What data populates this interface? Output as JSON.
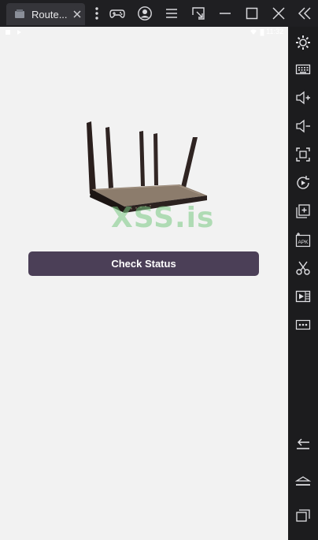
{
  "window": {
    "tab_title": "Route...",
    "icons": [
      "app-icon",
      "close-icon",
      "more-icon",
      "gamepad-icon",
      "account-icon",
      "menu-icon",
      "expand-icon",
      "minimize-icon",
      "maximize-icon",
      "close-window-icon",
      "collapse-sidebar-icon"
    ]
  },
  "sidebar": {
    "icons": [
      "settings-icon",
      "keyboard-icon",
      "volume-up-icon",
      "volume-down-icon",
      "fullscreen-icon",
      "rotate-icon",
      "add-window-icon",
      "apk-icon",
      "scissors-icon",
      "video-icon",
      "more-dots-icon",
      "back-icon",
      "home-icon",
      "recents-icon"
    ],
    "apk_label": "APK"
  },
  "status_bar": {
    "time": "11:32"
  },
  "app": {
    "router_image": "router-image",
    "watermark": "XSS.is",
    "check_status_label": "Check Status",
    "button_color": "#4b3f57"
  }
}
